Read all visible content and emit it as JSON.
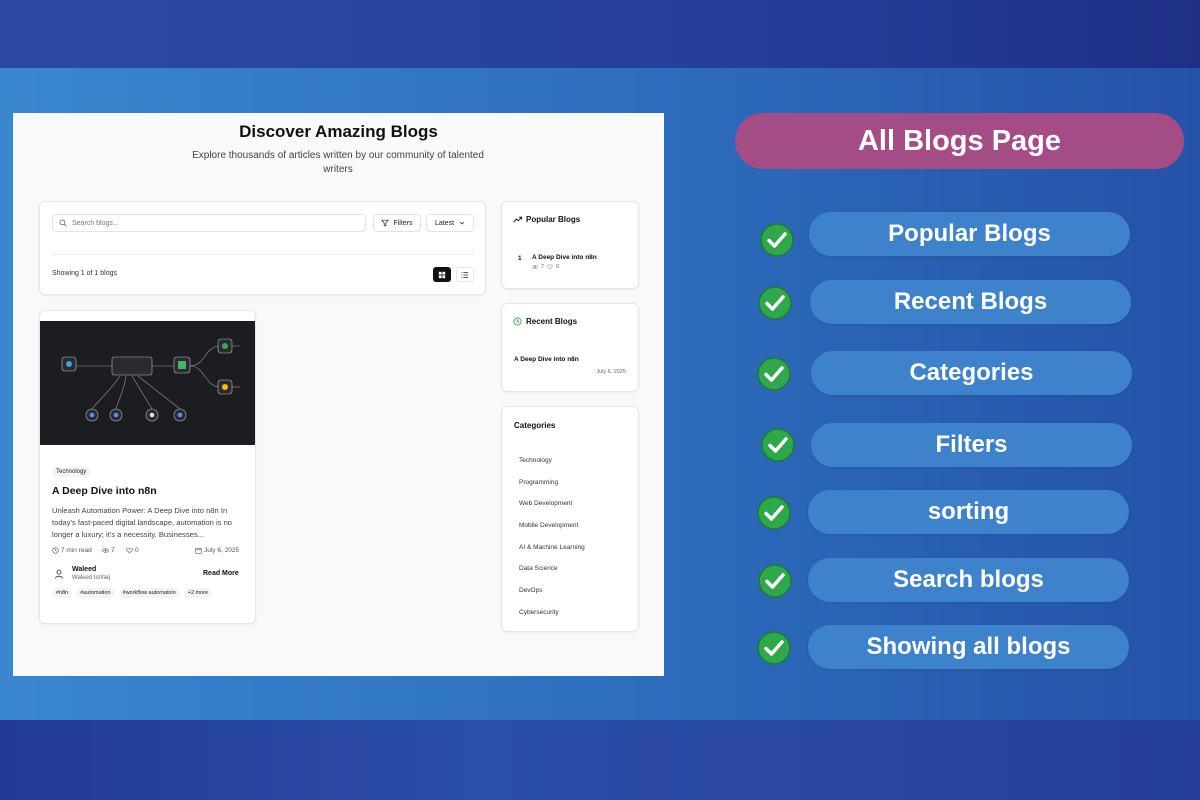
{
  "page": {
    "title": "Discover Amazing Blogs",
    "subtitle": "Explore thousands of articles written by our community of talented writers"
  },
  "toolbar": {
    "search_placeholder": "Search blogs...",
    "filters_label": "Filters",
    "sort_value": "Latest",
    "showing_text": "Showing 1 of 1 blogs"
  },
  "blog": {
    "category": "Technology",
    "title": "A Deep Dive into n8n",
    "excerpt": "Unleash Automation Power: A Deep Dive into n8n In today's fast-paced digital landscape, automation is no longer a luxury; it's a necessity. Businesses...",
    "read_time": "7 min read",
    "views": "7",
    "likes": "0",
    "date": "July 6, 2025",
    "author_name": "Waleed",
    "author_handle": "Waleed Ishfaq",
    "read_more": "Read More",
    "tags": [
      "#n8n",
      "#automation",
      "#workflow automation",
      "+2 more"
    ]
  },
  "sidebar": {
    "popular_title": "Popular Blogs",
    "popular_items": [
      {
        "rank": "1",
        "title": "A Deep Dive into n8n",
        "views": "7",
        "likes": "0"
      }
    ],
    "recent_title": "Recent Blogs",
    "recent_items": [
      {
        "title": "A Deep Dive into n8n",
        "date": "July 6, 2025"
      }
    ],
    "categories_title": "Categories",
    "categories": [
      "Technology",
      "Programming",
      "Web Development",
      "Mobile Development",
      "AI & Machine Learning",
      "Data Science",
      "DevOps",
      "Cybersecurity"
    ]
  },
  "features": {
    "heading": "All Blogs Page",
    "items": [
      "Popular Blogs",
      "Recent Blogs",
      "Categories",
      "Filters",
      "sorting",
      "Search blogs",
      "Showing all blogs"
    ]
  },
  "colors": {
    "heading_pill": "#a44c86",
    "feature_pill": "#3d82cb",
    "check_green": "#2ea84a"
  },
  "icons": {
    "search": "search-icon",
    "filter": "filter-icon",
    "chevron": "chevron-down-icon",
    "trending": "trending-up-icon",
    "clock": "clock-icon",
    "check": "check-circle-icon"
  }
}
